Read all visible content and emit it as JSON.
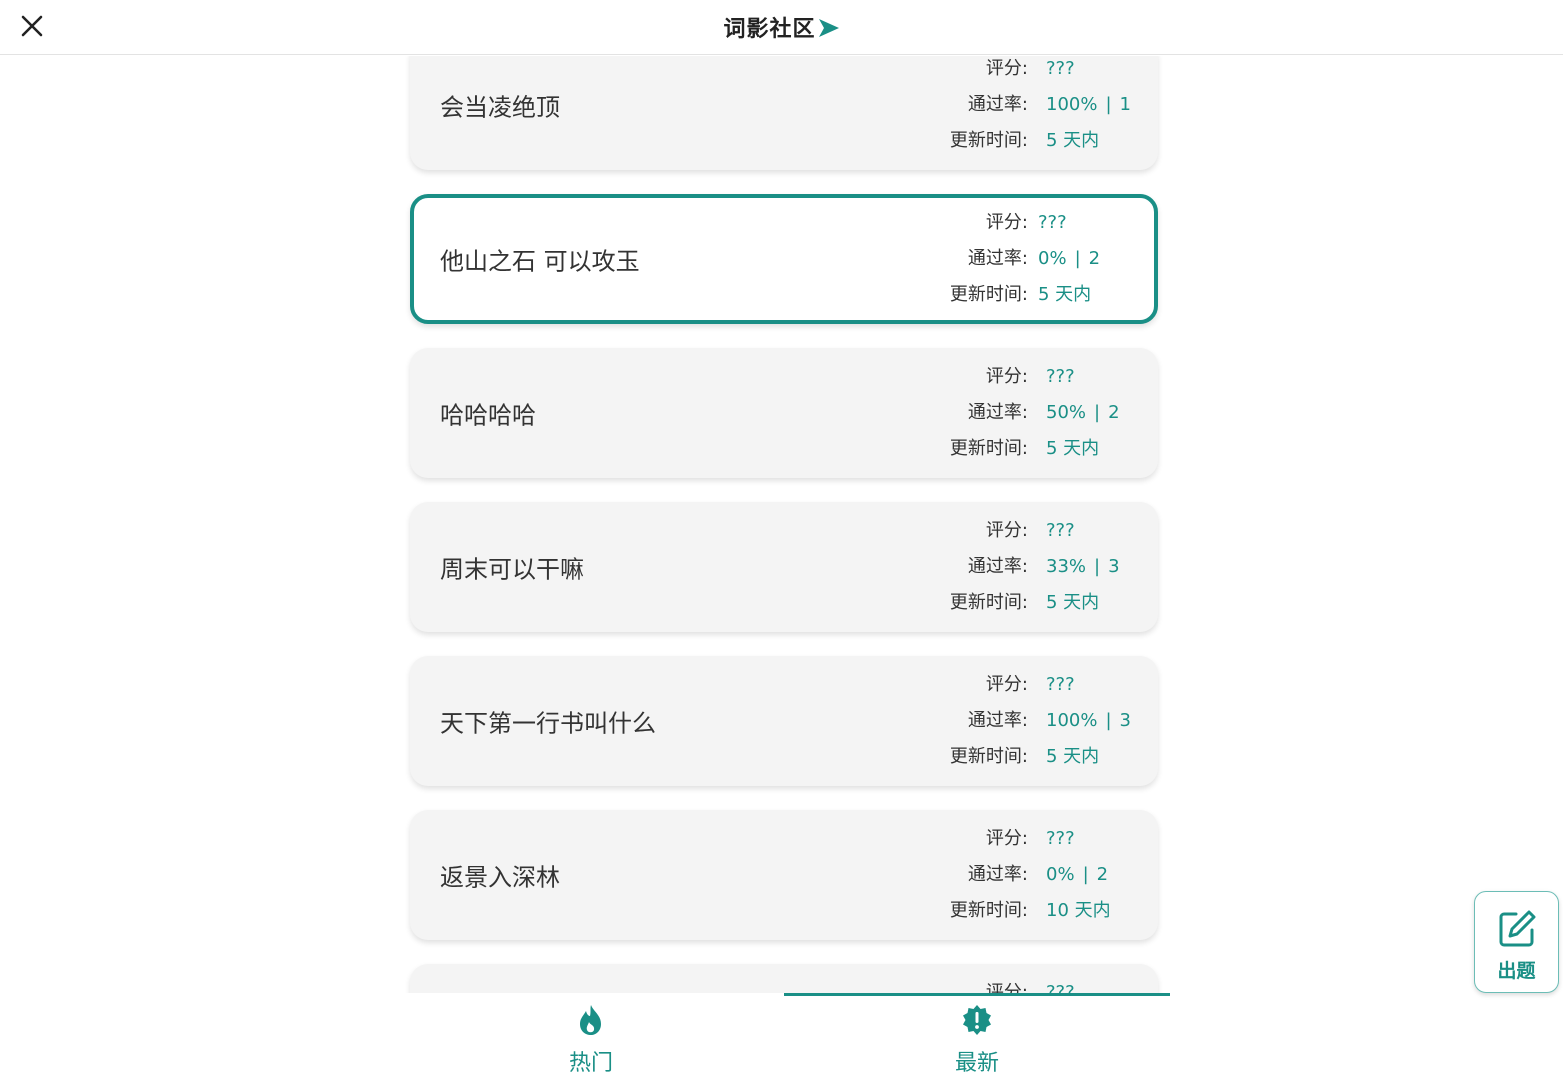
{
  "header": {
    "title": "词影社区",
    "close_icon": "close-icon",
    "title_icon": "arrow-right-icon"
  },
  "labels": {
    "rating": "评分:",
    "pass_rate": "通过率:",
    "updated": "更新时间:",
    "separator": "|"
  },
  "items": [
    {
      "title": "会当凌绝顶",
      "rating": "???",
      "pass_rate": "100%",
      "attempts": "1",
      "updated": "5 天内",
      "selected": false
    },
    {
      "title": "他山之石 可以攻玉",
      "rating": "???",
      "pass_rate": "0%",
      "attempts": "2",
      "updated": "5 天内",
      "selected": true
    },
    {
      "title": "哈哈哈哈",
      "rating": "???",
      "pass_rate": "50%",
      "attempts": "2",
      "updated": "5 天内",
      "selected": false
    },
    {
      "title": "周末可以干嘛",
      "rating": "???",
      "pass_rate": "33%",
      "attempts": "3",
      "updated": "5 天内",
      "selected": false
    },
    {
      "title": "天下第一行书叫什么",
      "rating": "???",
      "pass_rate": "100%",
      "attempts": "3",
      "updated": "5 天内",
      "selected": false
    },
    {
      "title": "返景入深林",
      "rating": "???",
      "pass_rate": "0%",
      "attempts": "2",
      "updated": "10 天内",
      "selected": false
    },
    {
      "title": "",
      "rating": "???",
      "pass_rate": "",
      "attempts": "",
      "updated": "",
      "selected": false
    }
  ],
  "tabs": [
    {
      "label": "热门",
      "icon": "flame-icon",
      "active": false
    },
    {
      "label": "最新",
      "icon": "new-badge-icon",
      "active": true
    }
  ],
  "fab": {
    "label": "出题",
    "icon": "edit-icon"
  },
  "colors": {
    "accent": "#1a8f86",
    "card_bg": "#f4f4f4",
    "text": "#333333"
  }
}
